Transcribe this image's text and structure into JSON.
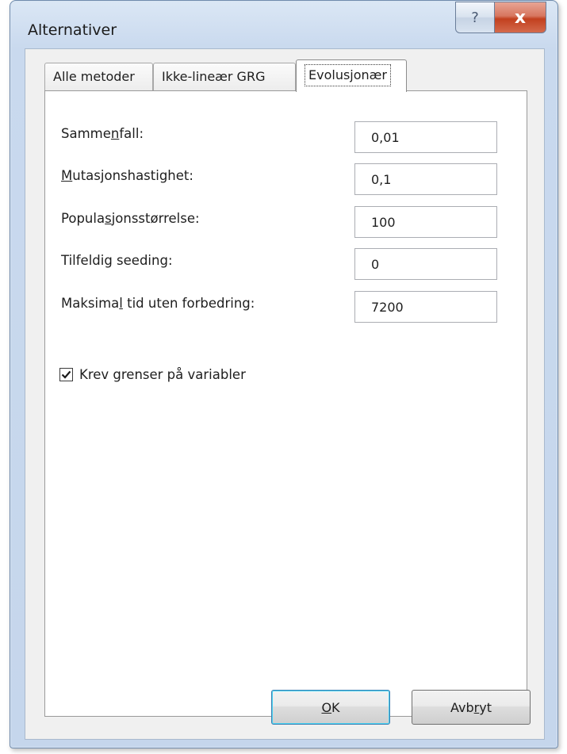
{
  "window": {
    "title": "Alternativer",
    "help_glyph": "?",
    "close_glyph": "x"
  },
  "tabs": [
    {
      "label": "Alle metoder",
      "active": false
    },
    {
      "label": "Ikke-lineær GRG",
      "active": false
    },
    {
      "label": "Evolusjonær",
      "active": true
    }
  ],
  "fields": [
    {
      "label_pre": "Samme",
      "label_mn": "n",
      "label_post": "fall:",
      "value": "0,01"
    },
    {
      "label_pre": "",
      "label_mn": "M",
      "label_post": "utasjonshastighet:",
      "value": "0,1"
    },
    {
      "label_pre": "Popula",
      "label_mn": "s",
      "label_post": "jonsstørrelse:",
      "value": "100"
    },
    {
      "label_pre": "Tilfeldig seeding:",
      "label_mn": "",
      "label_post": "",
      "value": "0"
    },
    {
      "label_pre": "Maksima",
      "label_mn": "l",
      "label_post": " tid uten forbedring:",
      "value": "7200"
    }
  ],
  "checkbox": {
    "label": "Krev grenser på variabler",
    "checked": true
  },
  "buttons": {
    "ok_mn": "O",
    "ok_rest": "K",
    "cancel_pre": "Avb",
    "cancel_mn": "r",
    "cancel_post": "yt"
  },
  "colors": {
    "accent_close": "#c2401f",
    "default_button_border": "#3c7fb1"
  }
}
